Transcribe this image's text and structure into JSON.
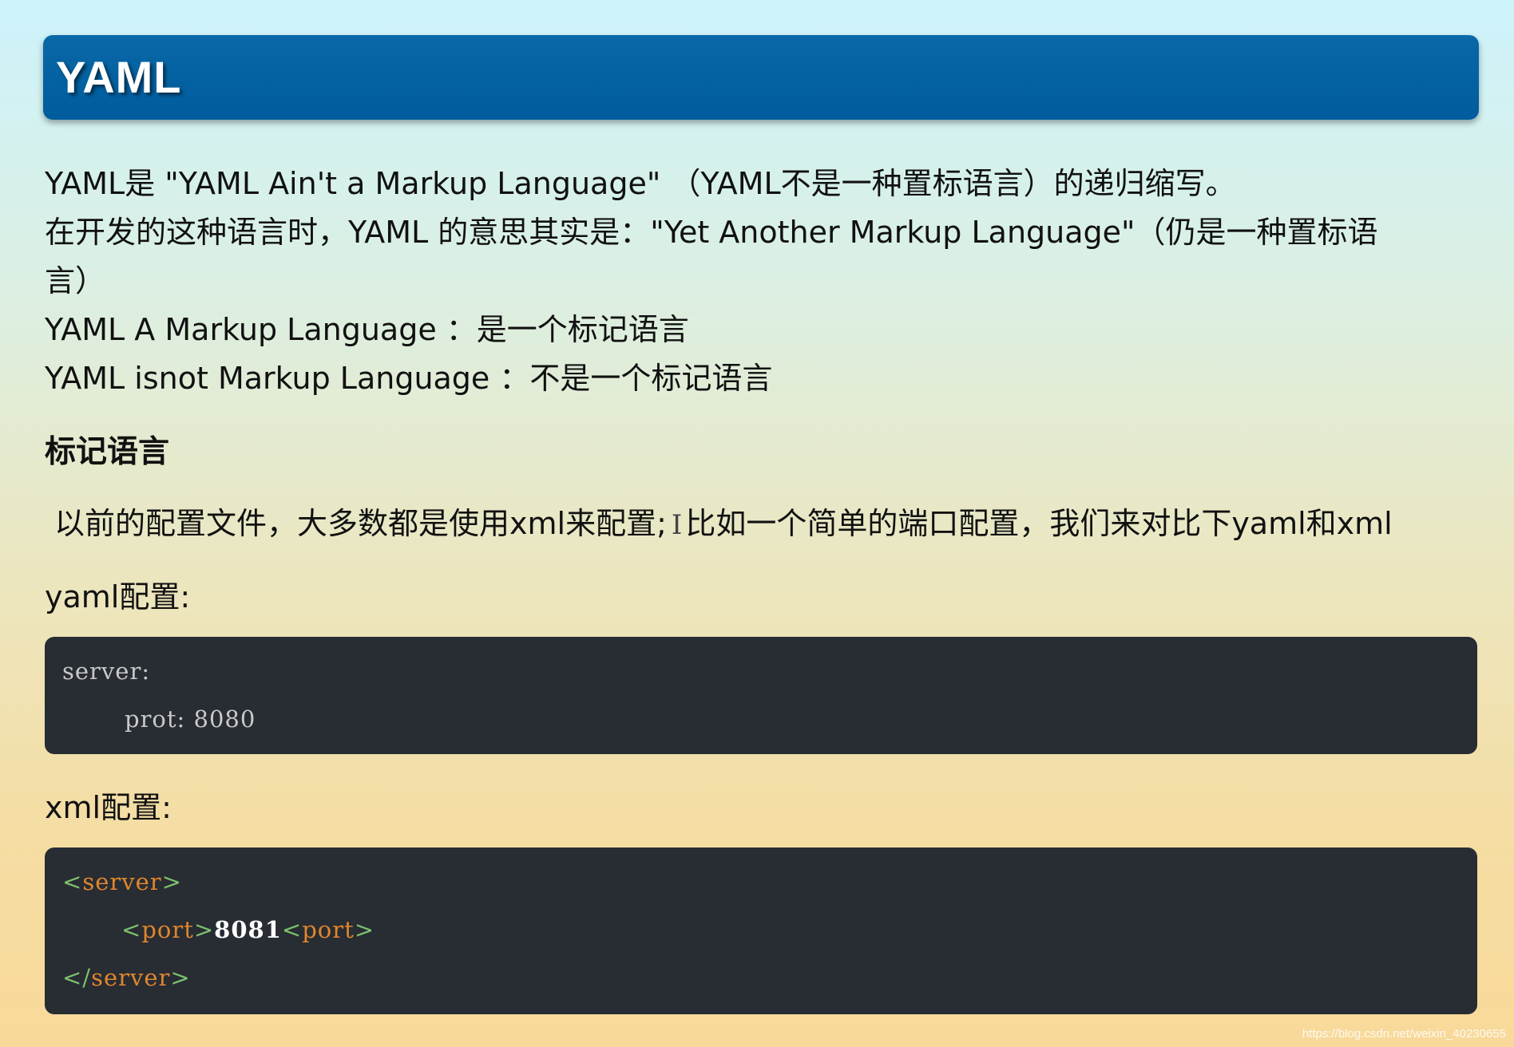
{
  "title": "YAML",
  "intro_lines": [
    "YAML是 \"YAML Ain't a Markup Language\" （YAML不是一种置标语言）的递归缩写。",
    "在开发的这种语言时，YAML 的意思其实是：\"Yet Another Markup Language\"（仍是一种置标语",
    "言）",
    "YAML A Markup Language ：是一个标记语言",
    "YAML isnot Markup Language ：不是一个标记语言"
  ],
  "section_heading": "标记语言",
  "description": {
    "part1": "以前的配置文件，大多数都是使用xml来配置;",
    "cursor": "I",
    "part2": "比如一个简单的端口配置，我们来对比下yaml和xml"
  },
  "yaml_label": "yaml配置:",
  "yaml_code": {
    "line1": "server:",
    "line2": "prot: 8080"
  },
  "xml_label": "xml配置:",
  "xml_code": {
    "open_lt": "<",
    "open_tag": "server",
    "open_gt": ">",
    "inner_lt1": "<",
    "inner_tag1": "port",
    "inner_gt1": ">",
    "inner_value": "8081",
    "inner_lt2": "<",
    "inner_tag2": "port",
    "inner_gt2": ">",
    "close_lt": "</",
    "close_tag": "server",
    "close_gt": ">"
  },
  "watermark": "https://blog.csdn.net/weixin_40230655",
  "colors": {
    "title_bar": "#005c9c",
    "code_bg": "#282c33",
    "xml_bracket": "#7cc16d",
    "xml_tag": "#e0862c"
  }
}
